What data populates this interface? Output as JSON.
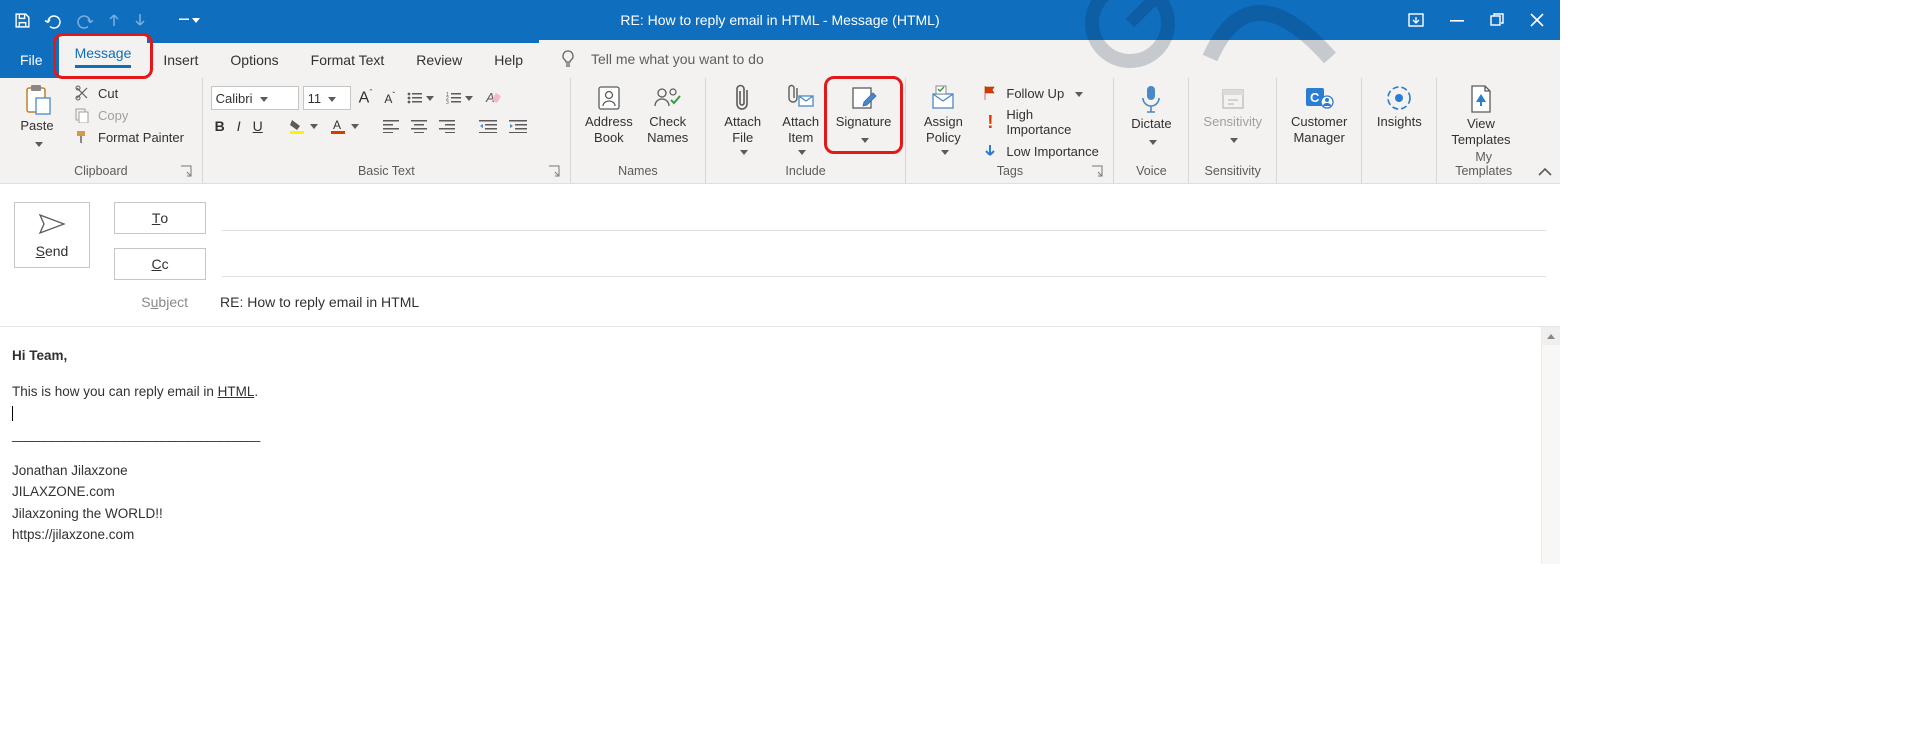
{
  "titlebar": {
    "title": "RE: How to reply email in HTML  -  Message (HTML)"
  },
  "tabs": {
    "file": "File",
    "message": "Message",
    "insert": "Insert",
    "options": "Options",
    "format_text": "Format Text",
    "review": "Review",
    "help": "Help",
    "tellme": "Tell me what you want to do"
  },
  "clipboard": {
    "paste": "Paste",
    "cut": "Cut",
    "copy": "Copy",
    "format_painter": "Format Painter",
    "label": "Clipboard"
  },
  "basictext": {
    "font_name": "Calibri",
    "font_size": "11",
    "label": "Basic Text"
  },
  "names": {
    "address_book": "Address\nBook",
    "check_names": "Check\nNames",
    "label": "Names"
  },
  "include": {
    "attach_file": "Attach\nFile",
    "attach_item": "Attach\nItem",
    "signature": "Signature",
    "label": "Include"
  },
  "tags": {
    "assign_policy": "Assign\nPolicy",
    "follow_up": "Follow Up",
    "high_importance": "High Importance",
    "low_importance": "Low Importance",
    "label": "Tags"
  },
  "voice": {
    "dictate": "Dictate",
    "label": "Voice"
  },
  "sensitivity": {
    "btn": "Sensitivity",
    "label": "Sensitivity"
  },
  "customer": {
    "btn": "Customer\nManager"
  },
  "insights": {
    "btn": "Insights"
  },
  "templates": {
    "btn": "View\nTemplates",
    "label": "My Templates"
  },
  "compose": {
    "send": "Send",
    "to": "To",
    "cc": "Cc",
    "subject_label": "Subject",
    "subject_value": "RE: How to reply email in HTML"
  },
  "body": {
    "greeting": "Hi Team,",
    "line1_a": "This is how you can reply email in ",
    "line1_b": "HTML",
    "line1_c": ".",
    "rule": "______________________________________",
    "sig1": "Jonathan Jilaxzone",
    "sig2": "JILAXZONE.com",
    "sig3": "Jilaxzoning the WORLD!!",
    "sig4": "https://jilaxzone.com"
  }
}
